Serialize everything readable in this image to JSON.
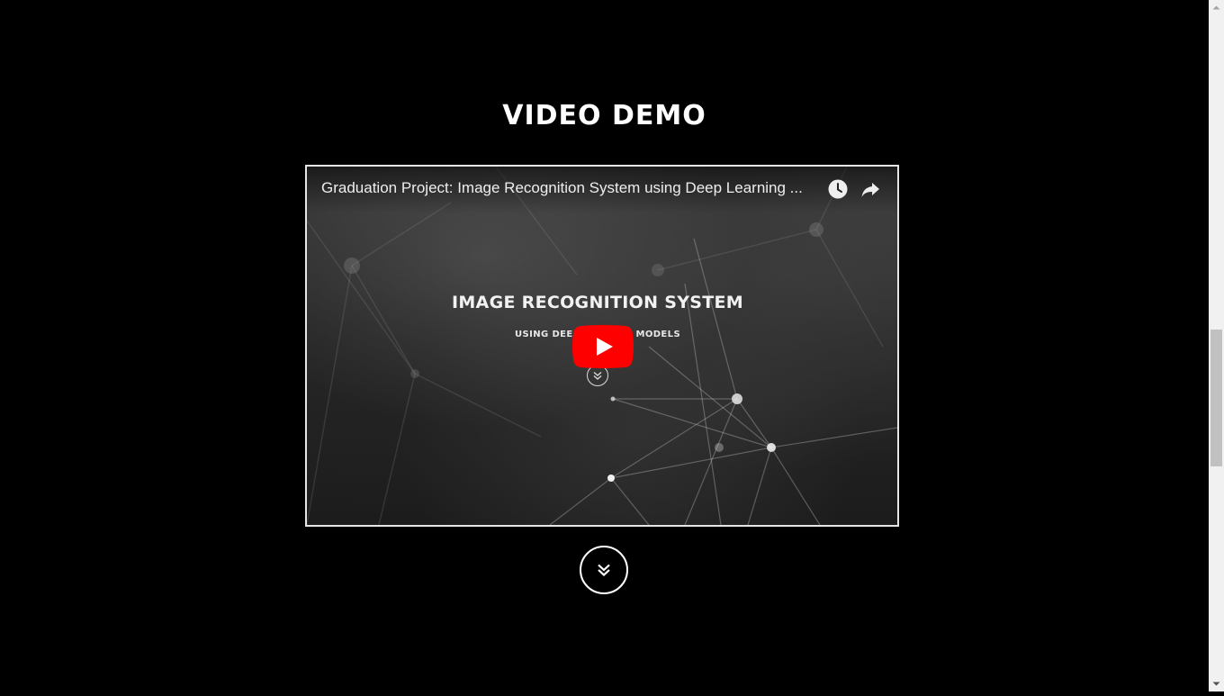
{
  "section": {
    "title": "VIDEO DEMO"
  },
  "video": {
    "title": "Graduation Project: Image Recognition System using Deep Learning ...",
    "overlay_heading": "IMAGE RECOGNITION SYSTEM",
    "overlay_subheading": "USING DEE                  MODELS",
    "icons": {
      "watch_later": "clock-icon",
      "share": "share-arrow-icon",
      "play": "youtube-play-icon",
      "overlay_chevron": "double-chevron-down-icon"
    },
    "colors": {
      "play_button": "#ff0000",
      "frame_border": "#e6e6e6"
    }
  },
  "scroll_down": {
    "icon": "double-chevron-down-icon"
  },
  "scrollbar": {
    "position_fraction": 0.48
  },
  "colors": {
    "background": "#000000",
    "text": "#ffffff"
  }
}
